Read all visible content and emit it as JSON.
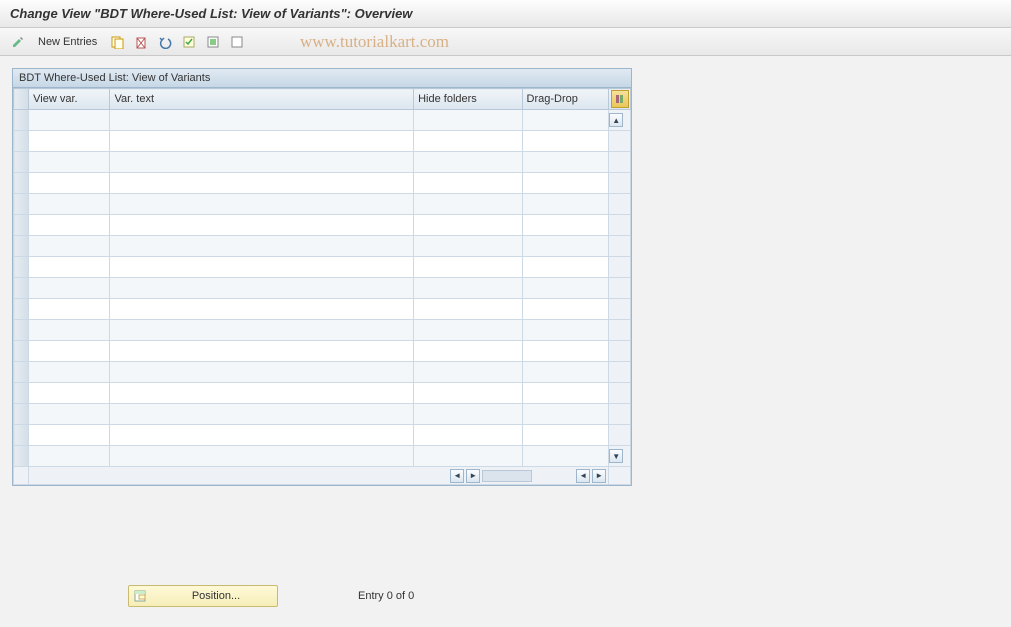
{
  "title": "Change View \"BDT Where-Used List: View of Variants\": Overview",
  "toolbar": {
    "new_entries_label": "New Entries"
  },
  "watermark": "www.tutorialkart.com",
  "panel": {
    "title": "BDT Where-Used List: View of Variants",
    "columns": {
      "view_var": "View var.",
      "var_text": "Var. text",
      "hide_folders": "Hide folders",
      "drag_drop": "Drag-Drop"
    },
    "rows": [
      {
        "view_var": "",
        "var_text": "",
        "hide_folders": "",
        "drag_drop": ""
      },
      {
        "view_var": "",
        "var_text": "",
        "hide_folders": "",
        "drag_drop": ""
      },
      {
        "view_var": "",
        "var_text": "",
        "hide_folders": "",
        "drag_drop": ""
      },
      {
        "view_var": "",
        "var_text": "",
        "hide_folders": "",
        "drag_drop": ""
      },
      {
        "view_var": "",
        "var_text": "",
        "hide_folders": "",
        "drag_drop": ""
      },
      {
        "view_var": "",
        "var_text": "",
        "hide_folders": "",
        "drag_drop": ""
      },
      {
        "view_var": "",
        "var_text": "",
        "hide_folders": "",
        "drag_drop": ""
      },
      {
        "view_var": "",
        "var_text": "",
        "hide_folders": "",
        "drag_drop": ""
      },
      {
        "view_var": "",
        "var_text": "",
        "hide_folders": "",
        "drag_drop": ""
      },
      {
        "view_var": "",
        "var_text": "",
        "hide_folders": "",
        "drag_drop": ""
      },
      {
        "view_var": "",
        "var_text": "",
        "hide_folders": "",
        "drag_drop": ""
      },
      {
        "view_var": "",
        "var_text": "",
        "hide_folders": "",
        "drag_drop": ""
      },
      {
        "view_var": "",
        "var_text": "",
        "hide_folders": "",
        "drag_drop": ""
      },
      {
        "view_var": "",
        "var_text": "",
        "hide_folders": "",
        "drag_drop": ""
      },
      {
        "view_var": "",
        "var_text": "",
        "hide_folders": "",
        "drag_drop": ""
      },
      {
        "view_var": "",
        "var_text": "",
        "hide_folders": "",
        "drag_drop": ""
      },
      {
        "view_var": "",
        "var_text": "",
        "hide_folders": "",
        "drag_drop": ""
      }
    ]
  },
  "footer": {
    "position_label": "Position...",
    "entry_text": "Entry 0 of 0"
  }
}
